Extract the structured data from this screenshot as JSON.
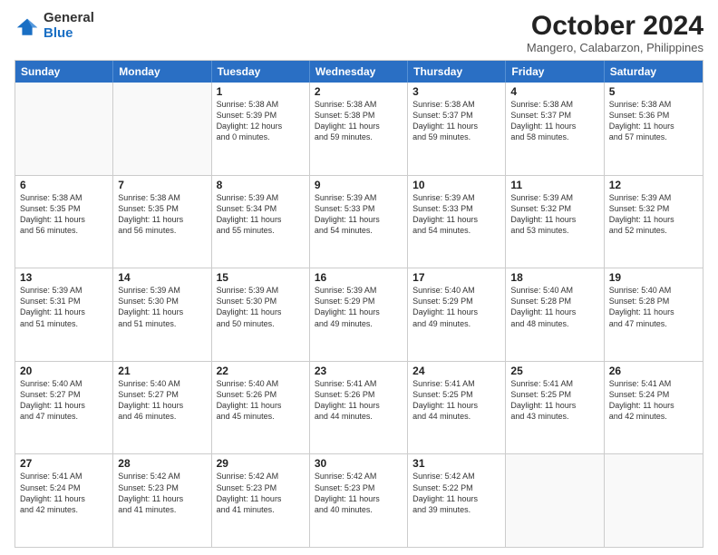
{
  "header": {
    "logo": {
      "general": "General",
      "blue": "Blue"
    },
    "title": "October 2024",
    "location": "Mangero, Calabarzon, Philippines"
  },
  "days_of_week": [
    "Sunday",
    "Monday",
    "Tuesday",
    "Wednesday",
    "Thursday",
    "Friday",
    "Saturday"
  ],
  "weeks": [
    [
      {
        "day": "",
        "empty": true
      },
      {
        "day": "",
        "empty": true
      },
      {
        "day": "1",
        "lines": [
          "Sunrise: 5:38 AM",
          "Sunset: 5:39 PM",
          "Daylight: 12 hours",
          "and 0 minutes."
        ]
      },
      {
        "day": "2",
        "lines": [
          "Sunrise: 5:38 AM",
          "Sunset: 5:38 PM",
          "Daylight: 11 hours",
          "and 59 minutes."
        ]
      },
      {
        "day": "3",
        "lines": [
          "Sunrise: 5:38 AM",
          "Sunset: 5:37 PM",
          "Daylight: 11 hours",
          "and 59 minutes."
        ]
      },
      {
        "day": "4",
        "lines": [
          "Sunrise: 5:38 AM",
          "Sunset: 5:37 PM",
          "Daylight: 11 hours",
          "and 58 minutes."
        ]
      },
      {
        "day": "5",
        "lines": [
          "Sunrise: 5:38 AM",
          "Sunset: 5:36 PM",
          "Daylight: 11 hours",
          "and 57 minutes."
        ]
      }
    ],
    [
      {
        "day": "6",
        "lines": [
          "Sunrise: 5:38 AM",
          "Sunset: 5:35 PM",
          "Daylight: 11 hours",
          "and 56 minutes."
        ]
      },
      {
        "day": "7",
        "lines": [
          "Sunrise: 5:38 AM",
          "Sunset: 5:35 PM",
          "Daylight: 11 hours",
          "and 56 minutes."
        ]
      },
      {
        "day": "8",
        "lines": [
          "Sunrise: 5:39 AM",
          "Sunset: 5:34 PM",
          "Daylight: 11 hours",
          "and 55 minutes."
        ]
      },
      {
        "day": "9",
        "lines": [
          "Sunrise: 5:39 AM",
          "Sunset: 5:33 PM",
          "Daylight: 11 hours",
          "and 54 minutes."
        ]
      },
      {
        "day": "10",
        "lines": [
          "Sunrise: 5:39 AM",
          "Sunset: 5:33 PM",
          "Daylight: 11 hours",
          "and 54 minutes."
        ]
      },
      {
        "day": "11",
        "lines": [
          "Sunrise: 5:39 AM",
          "Sunset: 5:32 PM",
          "Daylight: 11 hours",
          "and 53 minutes."
        ]
      },
      {
        "day": "12",
        "lines": [
          "Sunrise: 5:39 AM",
          "Sunset: 5:32 PM",
          "Daylight: 11 hours",
          "and 52 minutes."
        ]
      }
    ],
    [
      {
        "day": "13",
        "lines": [
          "Sunrise: 5:39 AM",
          "Sunset: 5:31 PM",
          "Daylight: 11 hours",
          "and 51 minutes."
        ]
      },
      {
        "day": "14",
        "lines": [
          "Sunrise: 5:39 AM",
          "Sunset: 5:30 PM",
          "Daylight: 11 hours",
          "and 51 minutes."
        ]
      },
      {
        "day": "15",
        "lines": [
          "Sunrise: 5:39 AM",
          "Sunset: 5:30 PM",
          "Daylight: 11 hours",
          "and 50 minutes."
        ]
      },
      {
        "day": "16",
        "lines": [
          "Sunrise: 5:39 AM",
          "Sunset: 5:29 PM",
          "Daylight: 11 hours",
          "and 49 minutes."
        ]
      },
      {
        "day": "17",
        "lines": [
          "Sunrise: 5:40 AM",
          "Sunset: 5:29 PM",
          "Daylight: 11 hours",
          "and 49 minutes."
        ]
      },
      {
        "day": "18",
        "lines": [
          "Sunrise: 5:40 AM",
          "Sunset: 5:28 PM",
          "Daylight: 11 hours",
          "and 48 minutes."
        ]
      },
      {
        "day": "19",
        "lines": [
          "Sunrise: 5:40 AM",
          "Sunset: 5:28 PM",
          "Daylight: 11 hours",
          "and 47 minutes."
        ]
      }
    ],
    [
      {
        "day": "20",
        "lines": [
          "Sunrise: 5:40 AM",
          "Sunset: 5:27 PM",
          "Daylight: 11 hours",
          "and 47 minutes."
        ]
      },
      {
        "day": "21",
        "lines": [
          "Sunrise: 5:40 AM",
          "Sunset: 5:27 PM",
          "Daylight: 11 hours",
          "and 46 minutes."
        ]
      },
      {
        "day": "22",
        "lines": [
          "Sunrise: 5:40 AM",
          "Sunset: 5:26 PM",
          "Daylight: 11 hours",
          "and 45 minutes."
        ]
      },
      {
        "day": "23",
        "lines": [
          "Sunrise: 5:41 AM",
          "Sunset: 5:26 PM",
          "Daylight: 11 hours",
          "and 44 minutes."
        ]
      },
      {
        "day": "24",
        "lines": [
          "Sunrise: 5:41 AM",
          "Sunset: 5:25 PM",
          "Daylight: 11 hours",
          "and 44 minutes."
        ]
      },
      {
        "day": "25",
        "lines": [
          "Sunrise: 5:41 AM",
          "Sunset: 5:25 PM",
          "Daylight: 11 hours",
          "and 43 minutes."
        ]
      },
      {
        "day": "26",
        "lines": [
          "Sunrise: 5:41 AM",
          "Sunset: 5:24 PM",
          "Daylight: 11 hours",
          "and 42 minutes."
        ]
      }
    ],
    [
      {
        "day": "27",
        "lines": [
          "Sunrise: 5:41 AM",
          "Sunset: 5:24 PM",
          "Daylight: 11 hours",
          "and 42 minutes."
        ]
      },
      {
        "day": "28",
        "lines": [
          "Sunrise: 5:42 AM",
          "Sunset: 5:23 PM",
          "Daylight: 11 hours",
          "and 41 minutes."
        ]
      },
      {
        "day": "29",
        "lines": [
          "Sunrise: 5:42 AM",
          "Sunset: 5:23 PM",
          "Daylight: 11 hours",
          "and 41 minutes."
        ]
      },
      {
        "day": "30",
        "lines": [
          "Sunrise: 5:42 AM",
          "Sunset: 5:23 PM",
          "Daylight: 11 hours",
          "and 40 minutes."
        ]
      },
      {
        "day": "31",
        "lines": [
          "Sunrise: 5:42 AM",
          "Sunset: 5:22 PM",
          "Daylight: 11 hours",
          "and 39 minutes."
        ]
      },
      {
        "day": "",
        "empty": true
      },
      {
        "day": "",
        "empty": true
      }
    ]
  ]
}
